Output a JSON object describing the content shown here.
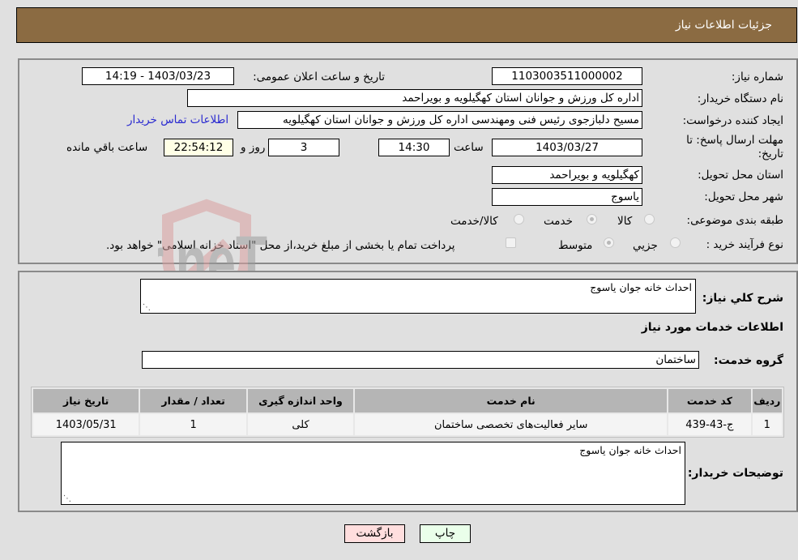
{
  "header": {
    "title": "جزئیات اطلاعات نیاز"
  },
  "details": {
    "need_number_label": "شماره نیاز:",
    "need_number": "1103003511000002",
    "announce_label": "تاریخ و ساعت اعلان عمومی:",
    "announce_value": "1403/03/23 - 14:19",
    "buyer_org_label": "نام دستگاه خریدار:",
    "buyer_org": "اداره کل ورزش و جوانان استان کهگیلویه و بویراحمد",
    "creator_label": "ایجاد کننده درخواست:",
    "creator": "مسیح دلبازجوی رئیس فنی ومهندسی اداره کل ورزش و جوانان استان کهگیلویه",
    "contact_link": "اطلاعات تماس خریدار",
    "deadline_label_1": "مهلت ارسال پاسخ: تا",
    "deadline_label_2": "تاریخ:",
    "deadline_date": "1403/03/27",
    "time_label": "ساعت",
    "deadline_time": "14:30",
    "days": "3",
    "days_label": "روز و",
    "remaining": "22:54:12",
    "remaining_label": "ساعت باقي مانده",
    "province_label": "استان محل تحویل:",
    "province": "کهگیلویه و بویراحمد",
    "city_label": "شهر محل تحویل:",
    "city": "یاسوج",
    "category_label": "طبقه بندی موضوعی:",
    "category_options": [
      {
        "label": "کالا",
        "selected": false
      },
      {
        "label": "خدمت",
        "selected": true
      },
      {
        "label": "کالا/خدمت",
        "selected": false
      }
    ],
    "process_label": "نوع فرآیند خرید :",
    "process_options": [
      {
        "label": "جزیي",
        "selected": false
      },
      {
        "label": "متوسط",
        "selected": true
      }
    ],
    "treasury_note": "پرداخت تمام یا بخشی از مبلغ خرید،از محل \"اسناد خزانه اسلامی\" خواهد بود.",
    "treasury_checked": false
  },
  "summary": {
    "general_desc_label": "شرح کلي نیاز:",
    "general_desc": "احداث خانه جوان یاسوج",
    "services_heading": "اطلاعات خدمات مورد نیاز",
    "service_group_label": "گروه خدمت:",
    "service_group": "ساختمان",
    "table": {
      "headers": [
        "ردیف",
        "کد خدمت",
        "نام خدمت",
        "واحد اندازه گیری",
        "تعداد / مقدار",
        "تاریخ نیاز"
      ],
      "rows": [
        [
          "1",
          "ج-43-439",
          "سایر فعالیت‌های تخصصی ساختمان",
          "کلی",
          "1",
          "1403/05/31"
        ]
      ]
    },
    "buyer_notes_label": "توضیحات خریدار:",
    "buyer_notes": "احداث خانه جوان یاسوج"
  },
  "buttons": {
    "print": "چاپ",
    "back": "بازگشت"
  },
  "watermark": {
    "text": "AriaTender.neT"
  },
  "colors": {
    "header_bg": "#8b6b42",
    "link": "#2a2ad0",
    "print_bg": "#eaffea",
    "back_bg": "#ffdede"
  }
}
